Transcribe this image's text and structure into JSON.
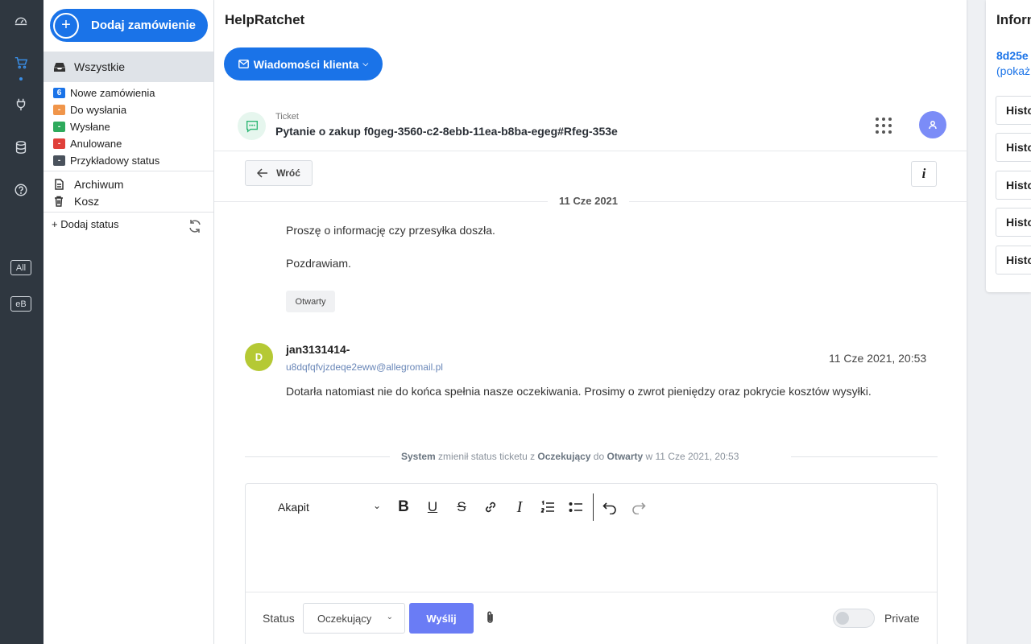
{
  "sidebar": {
    "add_order_label": "Dodaj zamówienie",
    "all_label": "Wszystkie",
    "statuses": [
      {
        "badge": "6",
        "label": "Nowe zamówienia",
        "color": "#1a73e8"
      },
      {
        "badge": "-",
        "label": "Do wysłania",
        "color": "#f0954a"
      },
      {
        "badge": "-",
        "label": "Wysłane",
        "color": "#2eaa5c"
      },
      {
        "badge": "-",
        "label": "Anulowane",
        "color": "#e0403a"
      },
      {
        "badge": "-",
        "label": "Przykładowy status",
        "color": "#4a525c"
      }
    ],
    "archive_label": "Archiwum",
    "trash_label": "Kosz",
    "add_status_label": "+ Dodaj status"
  },
  "rail": {
    "tag_all": "All",
    "tag_eb": "eB"
  },
  "main": {
    "title": "HelpRatchet",
    "messages_button": "Wiadomości klienta",
    "ticket_label": "Ticket",
    "ticket_title": "Pytanie o zakup f0geg-3560-c2-8ebb-11ea-b8ba-egeg#Rfeg-353e",
    "back_label": "Wróć",
    "info_label": "i",
    "date_divider": "11 Cze 2021",
    "message1": {
      "line1": "Proszę o informację czy przesyłka doszła.",
      "line2": "Pozdrawiam.",
      "tag": "Otwarty"
    },
    "message2": {
      "avatar_letter": "D",
      "sender": "jan3131414-",
      "email": "u8dqfqfvjzdeqe2eww@allegromail.pl",
      "time": "11 Cze 2021, 20:53",
      "text": "Dotarła natomiast nie do końca spełnia nasze oczekiwania. Prosimy o zwrot pieniędzy oraz pokrycie kosztów wysyłki."
    },
    "system_event": {
      "actor": "System",
      "t1": " zmienił status ticketu z ",
      "from": "Oczekujący",
      "t2": " do ",
      "to": "Otwarty",
      "t3": " w 11 Cze 2021, 20:53"
    }
  },
  "editor": {
    "format_select": "Akapit",
    "status_label": "Status",
    "status_value": "Oczekujący",
    "send_label": "Wyślij",
    "private_label": "Private",
    "private_on": false
  },
  "right_panel": {
    "title": "Informacje",
    "link": "8d25e",
    "sub": "(pokaż",
    "history_items": [
      "Histo",
      "Histo",
      "Histo",
      "Histo",
      "Histo"
    ]
  }
}
